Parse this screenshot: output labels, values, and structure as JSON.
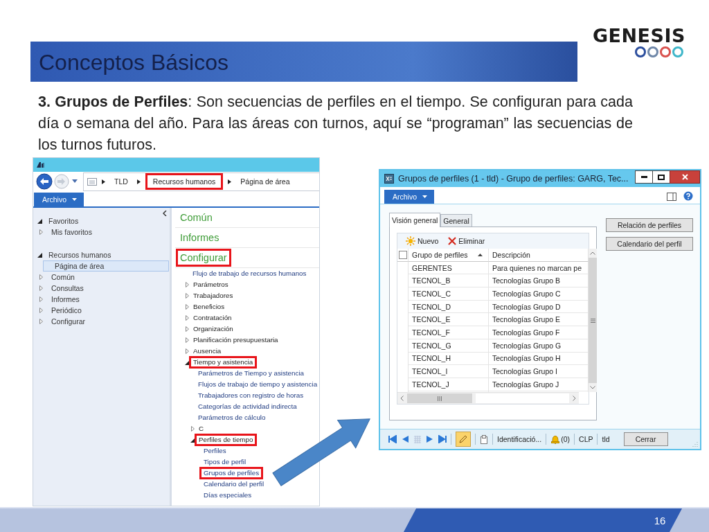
{
  "slide": {
    "title": "Conceptos Básicos",
    "logo": "GENESIS",
    "paragraph": "**3. Grupos de Perfiles**: Son secuencias de perfiles en el tiempo. Se configuran para cada día o semana del año. Para las áreas con turnos, aquí se “programan” las secuencias de los turnos futuros.",
    "page_number": "16"
  },
  "main_window": {
    "breadcrumb": [
      {
        "label": "TLD",
        "highlighted": false
      },
      {
        "label": "Recursos humanos",
        "highlighted": true
      },
      {
        "label": "Página de área",
        "highlighted": false
      }
    ],
    "file_menu": "Archivo",
    "nav_tree": [
      {
        "label": "Favoritos",
        "kind": "group",
        "expanded": true,
        "selected": false,
        "children": [
          {
            "label": "Mis favoritos",
            "kind": "group",
            "expanded": false,
            "selected": false
          }
        ]
      },
      {
        "label": "Recursos humanos",
        "kind": "group",
        "expanded": true,
        "selected": false,
        "children": [
          {
            "label": "Página de área",
            "kind": "page",
            "selected": true
          },
          {
            "label": "Común",
            "kind": "group",
            "expanded": false,
            "selected": false
          },
          {
            "label": "Consultas",
            "kind": "group",
            "expanded": false,
            "selected": false
          },
          {
            "label": "Informes",
            "kind": "group",
            "expanded": false,
            "selected": false
          },
          {
            "label": "Periódico",
            "kind": "group",
            "expanded": false,
            "selected": false
          },
          {
            "label": "Configurar",
            "kind": "group",
            "expanded": false,
            "selected": false
          }
        ]
      }
    ],
    "sections": [
      {
        "label": "Común",
        "highlighted": false
      },
      {
        "label": "Informes",
        "highlighted": false
      },
      {
        "label": "Configurar",
        "highlighted": true
      }
    ],
    "area_items": [
      {
        "label": "Flujo de trabajo de recursos humanos",
        "kind": "link",
        "highlighted": false
      },
      {
        "label": "Parámetros",
        "kind": "group",
        "expanded": false,
        "highlighted": false
      },
      {
        "label": "Trabajadores",
        "kind": "group",
        "expanded": false,
        "highlighted": false
      },
      {
        "label": "Beneficios",
        "kind": "group",
        "expanded": false,
        "highlighted": false
      },
      {
        "label": "Contratación",
        "kind": "group",
        "expanded": false,
        "highlighted": false
      },
      {
        "label": "Organización",
        "kind": "group",
        "expanded": false,
        "highlighted": false
      },
      {
        "label": "Planificación presupuestaria",
        "kind": "group",
        "expanded": false,
        "highlighted": false
      },
      {
        "label": "Ausencia",
        "kind": "group",
        "expanded": false,
        "highlighted": false
      },
      {
        "label": "Tiempo y asistencia",
        "kind": "group",
        "expanded": true,
        "highlighted": true,
        "children": [
          {
            "label": "Parámetros de Tiempo y asistencia",
            "kind": "link",
            "highlighted": false
          },
          {
            "label": "Flujos de trabajo de tiempo y asistencia",
            "kind": "link",
            "highlighted": false
          },
          {
            "label": "Trabajadores con registro de horas",
            "kind": "link",
            "highlighted": false
          },
          {
            "label": "Categorías de actividad indirecta",
            "kind": "link",
            "highlighted": false
          },
          {
            "label": "Parámetros de cálculo",
            "kind": "link",
            "highlighted": false
          },
          {
            "label": "C",
            "kind": "group",
            "expanded": false,
            "highlighted": false
          },
          {
            "label": "Perfiles de tiempo",
            "kind": "group",
            "expanded": true,
            "highlighted": true,
            "children": [
              {
                "label": "Perfiles",
                "kind": "link",
                "highlighted": false
              },
              {
                "label": "Tipos de perfil",
                "kind": "link",
                "highlighted": false
              },
              {
                "label": "Grupos de perfiles",
                "kind": "link",
                "highlighted": true
              },
              {
                "label": "Calendario del perfil",
                "kind": "link",
                "highlighted": false
              },
              {
                "label": "Días especiales",
                "kind": "link",
                "highlighted": false
              }
            ]
          }
        ]
      }
    ]
  },
  "dialog": {
    "title": "Grupos de perfiles (1 - tld) - Grupo de perfiles: GARG, Tec...",
    "file_menu": "Archivo",
    "tabs": [
      {
        "label": "Visión general",
        "selected": true
      },
      {
        "label": "General",
        "selected": false
      }
    ],
    "toolbar": [
      {
        "label": "Nuevo",
        "kind": "new"
      },
      {
        "label": "Eliminar",
        "kind": "delete"
      }
    ],
    "select_all_checked": false,
    "columns": [
      {
        "label": "Grupo de perfiles",
        "sorted": true
      },
      {
        "label": "Descripción",
        "sorted": false
      }
    ],
    "rows": [
      {
        "group": "GERENTES",
        "description": "Para quienes no marcan pe"
      },
      {
        "group": "TECNOL_B",
        "description": "Tecnologías Grupo B"
      },
      {
        "group": "TECNOL_C",
        "description": "Tecnologías Grupo C"
      },
      {
        "group": "TECNOL_D",
        "description": "Tecnologías Grupo D"
      },
      {
        "group": "TECNOL_E",
        "description": "Tecnologías Grupo E"
      },
      {
        "group": "TECNOL_F",
        "description": "Tecnologías Grupo F"
      },
      {
        "group": "TECNOL_G",
        "description": "Tecnologías Grupo G"
      },
      {
        "group": "TECNOL_H",
        "description": "Tecnologías Grupo H"
      },
      {
        "group": "TECNOL_I",
        "description": "Tecnologías Grupo I"
      },
      {
        "group": "TECNOL_J",
        "description": "Tecnologías Grupo J"
      }
    ],
    "side_buttons": [
      "Relación de perfiles",
      "Calendario del perfil"
    ],
    "status_bar": {
      "edit_mode": true,
      "record": "Identificació...",
      "alerts": "(0)",
      "currency": "CLP",
      "company": "tld",
      "close_button": "Cerrar"
    }
  }
}
